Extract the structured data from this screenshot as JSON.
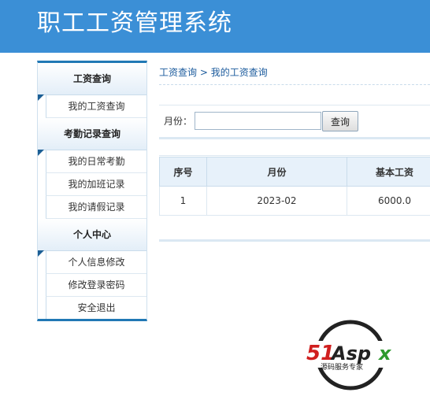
{
  "header": {
    "title": "职工工资管理系统"
  },
  "sidebar": {
    "sections": [
      {
        "title": "工资查询",
        "items": [
          "我的工资查询"
        ]
      },
      {
        "title": "考勤记录查询",
        "items": [
          "我的日常考勤",
          "我的加班记录",
          "我的请假记录"
        ]
      },
      {
        "title": "个人中心",
        "items": [
          "个人信息修改",
          "修改登录密码",
          "安全退出"
        ]
      }
    ]
  },
  "main": {
    "breadcrumb": {
      "parent": "工资查询",
      "separator": " > ",
      "current": "我的工资查询"
    },
    "search": {
      "label": "月份：",
      "value": "",
      "button_label": "查询"
    },
    "table": {
      "headers": [
        "序号",
        "月份",
        "基本工资"
      ],
      "rows": [
        [
          "1",
          "2023-02",
          "6000.0"
        ]
      ]
    }
  },
  "watermark": {
    "brand": "51Aspx",
    "tagline": "源码服务专家"
  },
  "colors": {
    "header_bg": "#3b8fd6",
    "accent": "#2178b5",
    "table_head_bg": "#e7f1fa"
  }
}
